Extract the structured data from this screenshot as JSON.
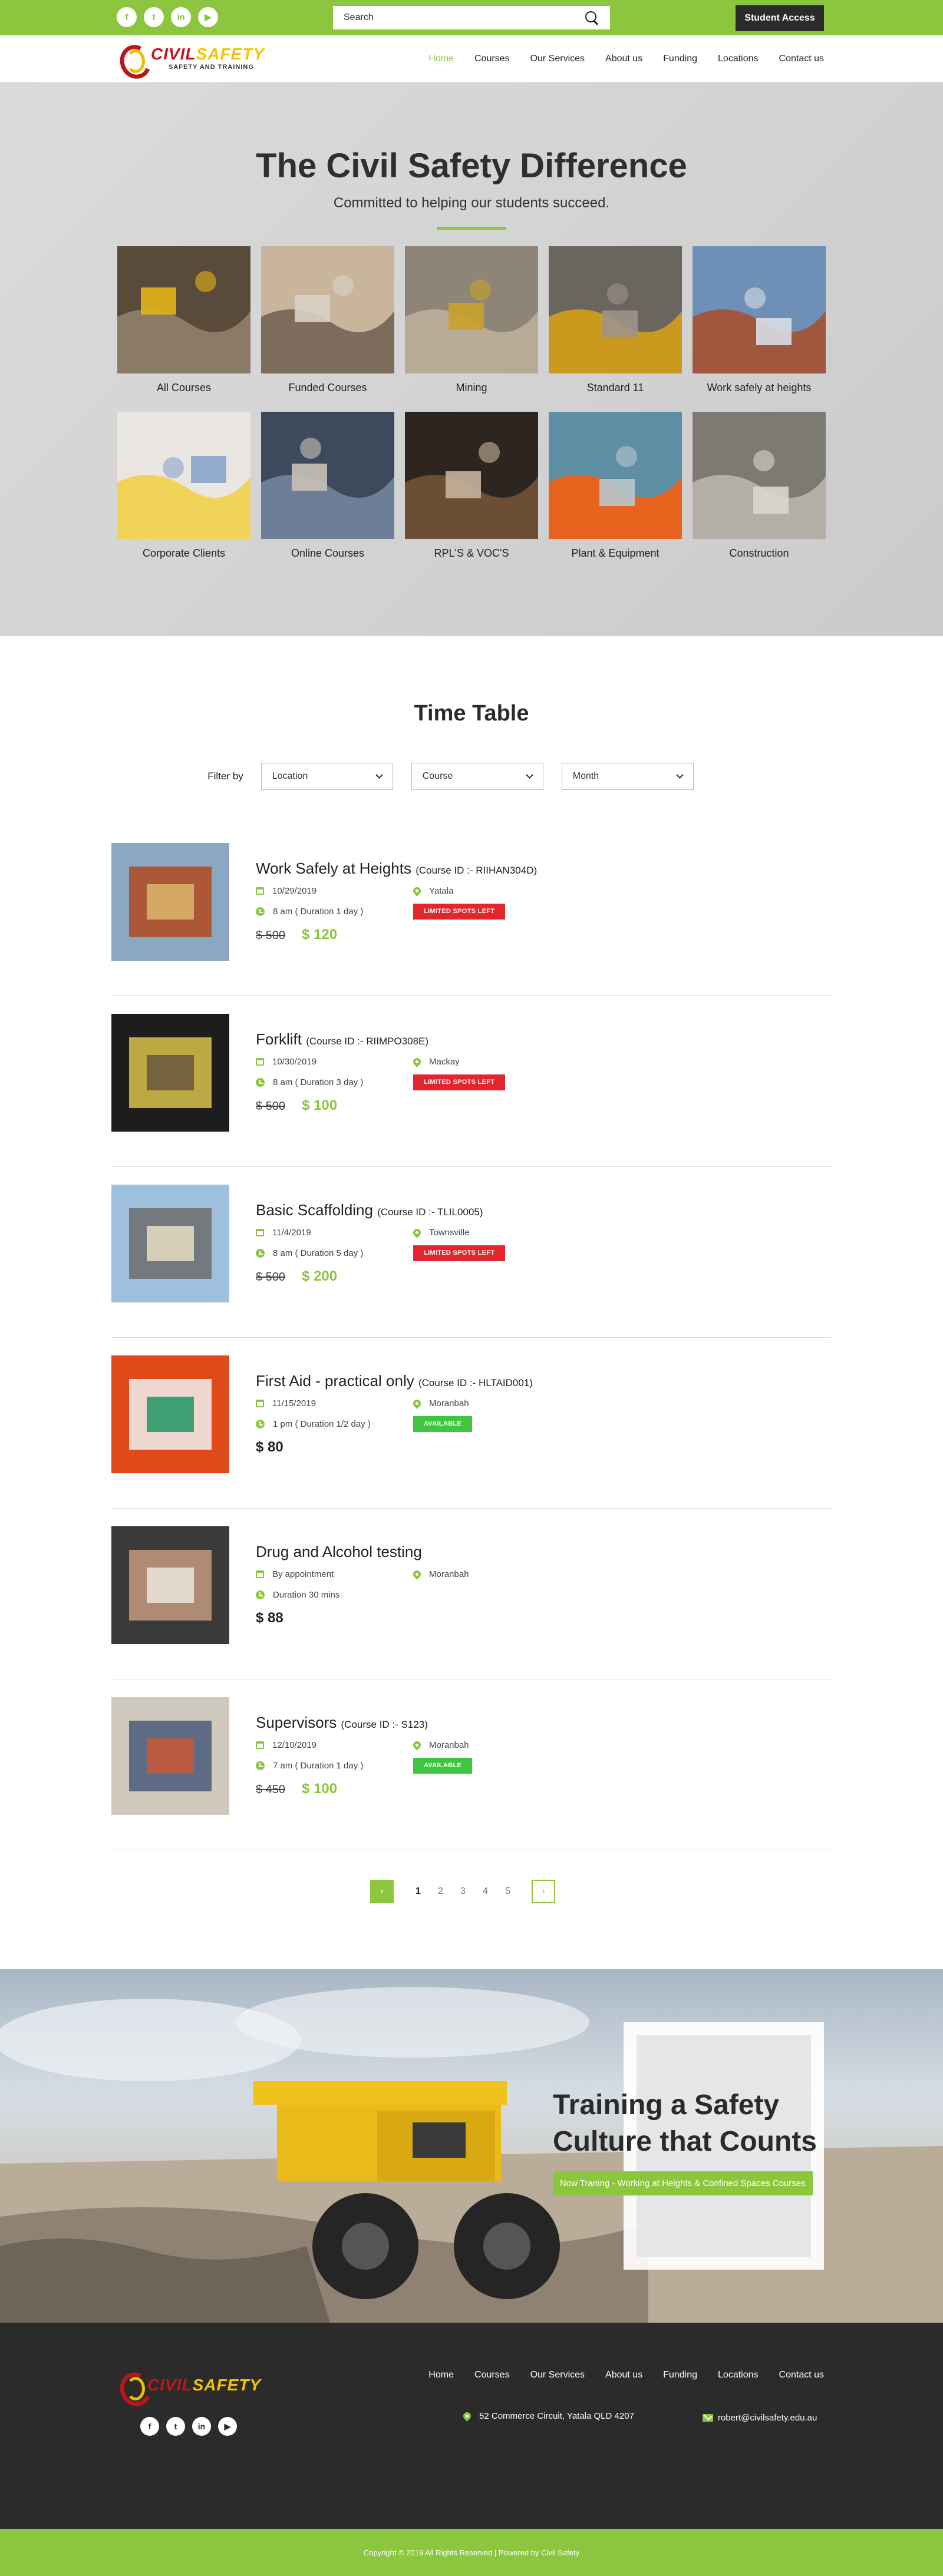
{
  "topbar": {
    "social": [
      {
        "glyph": "f",
        "icon": "facebook-icon"
      },
      {
        "glyph": "t",
        "icon": "twitter-icon"
      },
      {
        "glyph": "in",
        "icon": "linkedin-icon"
      },
      {
        "glyph": "▶",
        "icon": "youtube-icon"
      }
    ],
    "search_placeholder": "Search",
    "student_access": "Student Access"
  },
  "brand": {
    "civil": "CIVIL",
    "safety": "SAFETY",
    "tagline": "SAFETY AND TRAINING"
  },
  "nav": {
    "items": [
      "Home",
      "Courses",
      "Our Services",
      "About us",
      "Funding",
      "Locations",
      "Contact us"
    ],
    "active": "Home"
  },
  "hero": {
    "title": "The Civil Safety Difference",
    "subtitle": "Committed to helping our students succeed.",
    "categories": [
      "All Courses",
      "Funded Courses",
      "Mining",
      "Standard 11",
      "Work safely at heights",
      "Corporate Clients",
      "Online Courses",
      "RPL'S & VOC'S",
      "Plant & Equipment",
      "Construction"
    ]
  },
  "timetable": {
    "title": "Time Table",
    "filter_label": "Filter by",
    "filters": [
      "Location",
      "Course",
      "Month"
    ],
    "courses": [
      {
        "title": "Work Safely at Heights",
        "course_id": "(Course ID :- RIIHAN304D)",
        "date": "10/29/2019",
        "time": "8 am ( Duration 1 day )",
        "location": "Yatala",
        "badge": "LIMITED SPOTS LEFT",
        "badge_type": "limited",
        "old_price": "$ 500",
        "price": "$ 120"
      },
      {
        "title": "Forklift",
        "course_id": "(Course ID :- RIIMPO308E)",
        "date": "10/30/2019",
        "time": "8 am ( Duration 3 day )",
        "location": "Mackay",
        "badge": "LIMITED SPOTS LEFT",
        "badge_type": "limited",
        "old_price": "$ 500",
        "price": "$ 100"
      },
      {
        "title": "Basic Scaffolding",
        "course_id": "(Course ID :- TLIL0005)",
        "date": "11/4/2019",
        "time": "8 am ( Duration 5 day )",
        "location": "Townsville",
        "badge": "LIMITED SPOTS LEFT",
        "badge_type": "limited",
        "old_price": "$ 500",
        "price": "$ 200"
      },
      {
        "title": "First Aid - practical only",
        "course_id": "(Course ID :- HLTAID001)",
        "date": "11/15/2019",
        "time": "1 pm ( Duration 1/2 day )",
        "location": "Moranbah",
        "badge": "AVAILABLE",
        "badge_type": "available",
        "old_price": "",
        "price": "$ 80"
      },
      {
        "title": "Drug and Alcohol testing",
        "course_id": "",
        "date": "By appointment",
        "time": "Duration 30 mins",
        "location": "Moranbah",
        "badge": "",
        "badge_type": "",
        "old_price": "",
        "price": "$ 88"
      },
      {
        "title": "Supervisors",
        "course_id": "(Course ID :- S123)",
        "date": "12/10/2019",
        "time": "7 am ( Duration 1 day )",
        "location": "Moranbah",
        "badge": "AVAILABLE",
        "badge_type": "available",
        "old_price": "$ 450",
        "price": "$ 100"
      }
    ],
    "pagination": {
      "prev": "‹",
      "next": "›",
      "pages": [
        "1",
        "2",
        "3",
        "4",
        "5"
      ],
      "current": "1"
    }
  },
  "banner": {
    "headline_line1": "Training a Safety",
    "headline_line2": "Culture that Counts",
    "strip": "Now Traning - Working at Heights & Confined Spaces Courses"
  },
  "footer": {
    "menu": [
      "Home",
      "Courses",
      "Our Services",
      "About us",
      "Funding",
      "Locations",
      "Contact us"
    ],
    "address": "52 Commerce Circuit, Yatala QLD 4207",
    "email": "robert@civilsafety.edu.au",
    "social": [
      {
        "glyph": "f",
        "icon": "facebook-icon"
      },
      {
        "glyph": "t",
        "icon": "twitter-icon"
      },
      {
        "glyph": "in",
        "icon": "linkedin-icon"
      },
      {
        "glyph": "▶",
        "icon": "youtube-icon"
      }
    ],
    "copyright": "Copyright © 2019 All Rights Reserved | Powered by Civil Safety"
  },
  "colors": {
    "accent": "#8cc63f",
    "dark": "#2b2b2b",
    "limited": "#e3262e",
    "available": "#3fc63f"
  }
}
